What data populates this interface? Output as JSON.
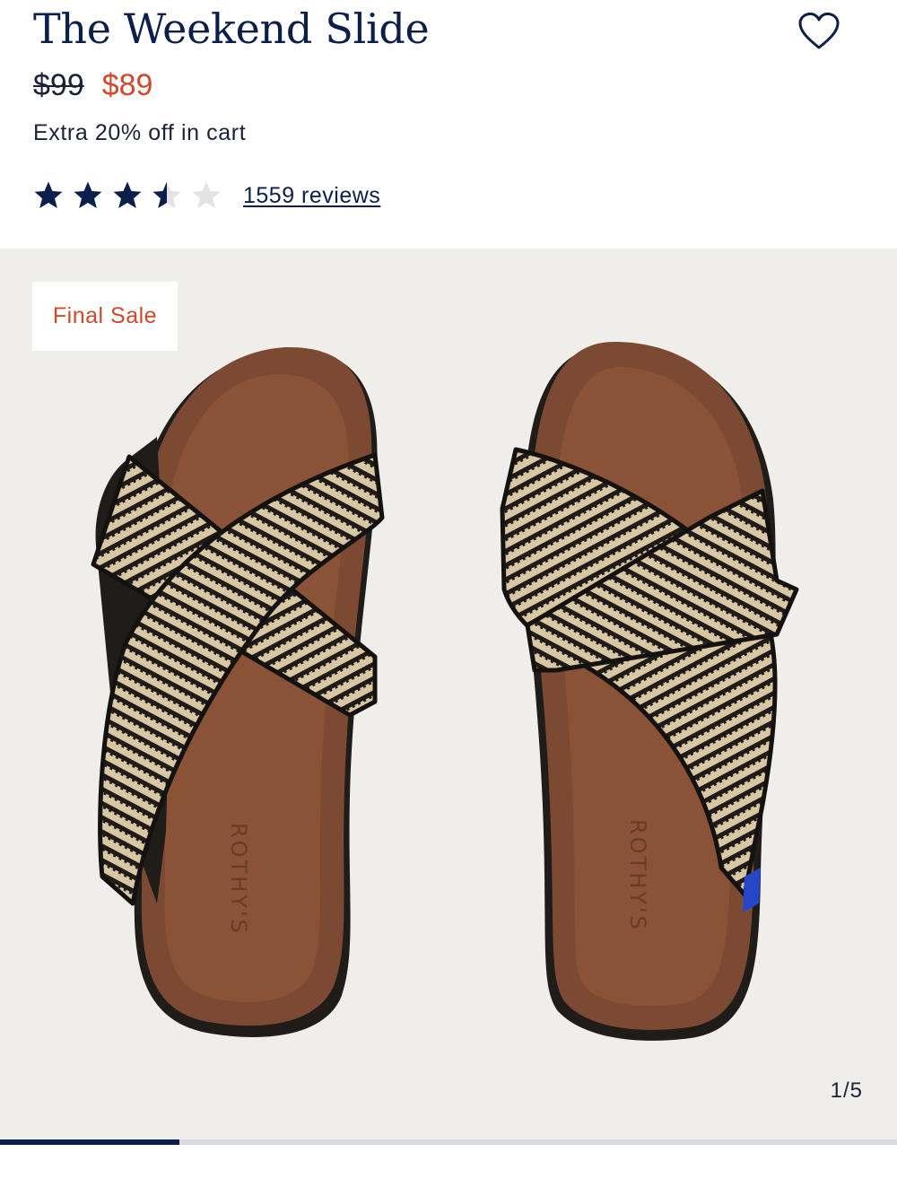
{
  "product": {
    "title": "The Weekend Slide",
    "price_original": "$99",
    "price_sale": "$89",
    "promo": "Extra 20% off in cart",
    "rating": {
      "value": 3.5,
      "max": 5,
      "reviews_label": "1559 reviews"
    }
  },
  "gallery": {
    "badge": "Final Sale",
    "counter": "1/5",
    "progress": 0.2,
    "insole_brand": "ROTHY'S"
  },
  "icons": {
    "favorite": "heart-outline-icon",
    "rating": "star-icon"
  },
  "colors": {
    "navy": "#0c1f4a",
    "sale_red": "#d1492d",
    "star_empty": "#e3e3e3",
    "gallery_bg": "#f0eeeb"
  }
}
